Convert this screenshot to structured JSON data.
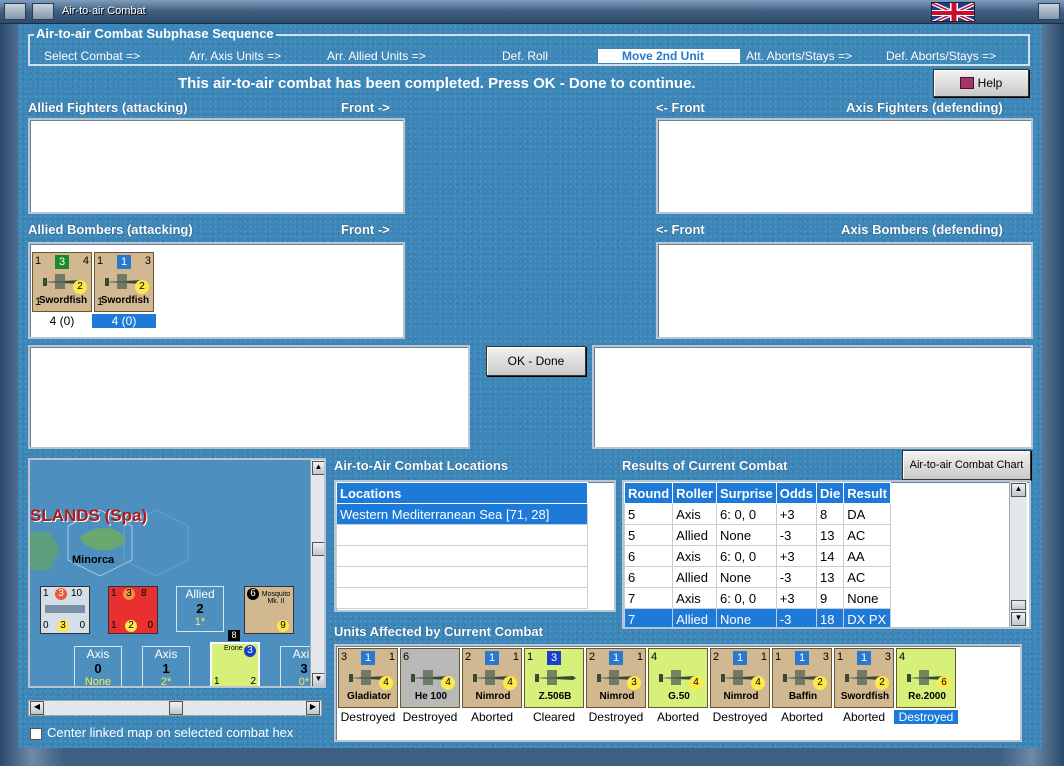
{
  "window": {
    "title": "Air-to-air Combat"
  },
  "colors": {
    "accent": "#1e7ad8",
    "background": "#3c86b8",
    "counter": "#d2b891"
  },
  "phases": {
    "legend": "Air-to-air Combat Subphase Sequence",
    "items": [
      {
        "label": "Select Combat =>"
      },
      {
        "label": "Arr. Axis Units =>"
      },
      {
        "label": "Arr. Allied Units =>"
      },
      {
        "label": "Def. Roll"
      },
      {
        "label": "Move 2nd Unit"
      },
      {
        "label": "Att. Aborts/Stays =>"
      },
      {
        "label": "Def. Aborts/Stays =>"
      }
    ],
    "active_index": 4
  },
  "status_message": "This air-to-air combat has been completed.  Press OK - Done to continue.",
  "help_button": {
    "label": "Help",
    "icon": "book-icon"
  },
  "allied_fighters": {
    "label": "Allied Fighters (attacking)",
    "front": "Front ->"
  },
  "axis_fighters": {
    "label": "Axis Fighters (defending)",
    "front": "<- Front"
  },
  "allied_bombers": {
    "label": "Allied Bombers (attacking)",
    "front": "Front ->",
    "units": [
      {
        "tl": "1",
        "sq": "3",
        "sq_color": "#1a8a2a",
        "tr": "4",
        "circle": "2",
        "name": "Swordfish",
        "bl": "1",
        "caption": "4 (0)",
        "selected": false
      },
      {
        "tl": "1",
        "sq": "1",
        "sq_color": "#2a78d0",
        "tr": "3",
        "circle": "2",
        "name": "Swordfish",
        "bl": "1",
        "caption": "4 (0)",
        "selected": true
      }
    ]
  },
  "axis_bombers": {
    "label": "Axis Bombers (defending)",
    "front": "<- Front"
  },
  "ok_button": {
    "label": "OK - Done"
  },
  "locations": {
    "title": "Air-to-Air Combat Locations",
    "header": "Locations",
    "rows": [
      "Western Mediterranean Sea [71, 28]"
    ]
  },
  "results": {
    "title": "Results of Current Combat",
    "chart_button": "Air-to-air Combat Chart",
    "columns": [
      "Round",
      "Roller",
      "Surprise",
      "Odds",
      "Die",
      "Result"
    ],
    "rows": [
      [
        "5",
        "Axis",
        "6: 0, 0",
        "+3",
        "8",
        "DA"
      ],
      [
        "5",
        "Allied",
        "None",
        "-3",
        "13",
        "AC"
      ],
      [
        "6",
        "Axis",
        "6: 0, 0",
        "+3",
        "14",
        "AA"
      ],
      [
        "6",
        "Allied",
        "None",
        "-3",
        "13",
        "AC"
      ],
      [
        "7",
        "Axis",
        "6: 0, 0",
        "+3",
        "9",
        "None"
      ],
      [
        "7",
        "Allied",
        "None",
        "-3",
        "18",
        "DX PX"
      ]
    ],
    "selected_row": 5
  },
  "affected": {
    "title": "Units Affected by Current Combat",
    "units": [
      {
        "tl": "3",
        "sq": "1",
        "sq_color": "#2a78d0",
        "tr": "1",
        "name": "Gladiator",
        "circle": "4",
        "bg": "#d2b891",
        "status": "Destroyed"
      },
      {
        "tl": "6",
        "sq": "",
        "sq_color": "",
        "tr": "",
        "name": "He 100",
        "circle": "4",
        "bg": "#b8b8b8",
        "status": "Destroyed"
      },
      {
        "tl": "2",
        "sq": "1",
        "sq_color": "#2a78d0",
        "tr": "1",
        "name": "Nimrod",
        "circle": "4",
        "bg": "#d2b891",
        "status": "Aborted"
      },
      {
        "tl": "1",
        "sq": "3",
        "sq_color": "#1a3fc8",
        "tr": "",
        "name": "Z.506B",
        "circle": "",
        "bg": "#d6f07a",
        "status": "Cleared"
      },
      {
        "tl": "2",
        "sq": "1",
        "sq_color": "#2a78d0",
        "tr": "1",
        "name": "Nimrod",
        "circle": "3",
        "bg": "#d2b891",
        "status": "Destroyed"
      },
      {
        "tl": "4",
        "sq": "",
        "sq_color": "",
        "tr": "",
        "name": "G.50",
        "circle": "4",
        "bg": "#d6f07a",
        "status": "Aborted"
      },
      {
        "tl": "2",
        "sq": "1",
        "sq_color": "#2a78d0",
        "tr": "1",
        "name": "Nimrod",
        "circle": "4",
        "bg": "#d2b891",
        "status": "Destroyed"
      },
      {
        "tl": "1",
        "sq": "1",
        "sq_color": "#2a78d0",
        "tr": "3",
        "name": "Baffin",
        "circle": "2",
        "bg": "#d2b891",
        "status": "Aborted"
      },
      {
        "tl": "1",
        "sq": "1",
        "sq_color": "#2a78d0",
        "tr": "3",
        "name": "Swordfish",
        "circle": "2",
        "bg": "#d2b891",
        "status": "Aborted"
      },
      {
        "tl": "4",
        "sq": "",
        "sq_color": "",
        "tr": "",
        "name": "Re.2000",
        "circle": "6",
        "bg": "#d6f07a",
        "status": "Destroyed",
        "selected": true
      }
    ]
  },
  "map": {
    "region": "SLANDS (Spa)",
    "hex_label": "Minorca",
    "allied": {
      "label": "Allied",
      "value": "2",
      "sub": "1*"
    },
    "axis_stats": [
      {
        "label": "Axis",
        "value": "0",
        "sub": "None"
      },
      {
        "label": "Axis",
        "value": "1",
        "sub": "2*"
      },
      {
        "label": "Axis",
        "value": "3",
        "sub": "0*"
      }
    ],
    "mosquito": "Mosquito Mk. II",
    "erone": "Erone",
    "badge_8": "8"
  },
  "center_map": {
    "label": "Center linked map on selected combat hex"
  }
}
